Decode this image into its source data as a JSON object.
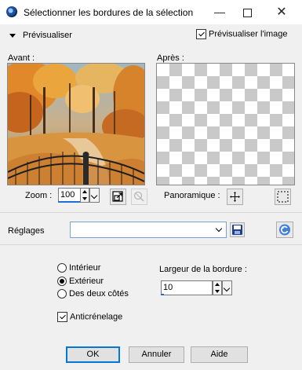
{
  "window": {
    "title": "Sélectionner les bordures de la sélection",
    "icon": "psp-app-icon",
    "min_symbol": "—",
    "close_symbol": "✕"
  },
  "preview": {
    "toggle_label": "Prévisualiser",
    "checkbox_label": "Prévisualiser l'image",
    "checkbox_checked": true
  },
  "before": {
    "label": "Avant :"
  },
  "after": {
    "label": "Après :"
  },
  "zoom": {
    "label": "Zoom :",
    "value": "100"
  },
  "pan": {
    "label": "Panoramique :"
  },
  "reglages": {
    "label": "Réglages",
    "value": ""
  },
  "options": {
    "radios": [
      {
        "label": "Intérieur",
        "checked": false
      },
      {
        "label": "Extérieur",
        "checked": true
      },
      {
        "label": "Des deux côtés",
        "checked": false
      }
    ],
    "border_width_label": "Largeur de la bordure :",
    "border_width_value": "10",
    "antialias_label": "Anticrénelage",
    "antialias_checked": true
  },
  "buttons": {
    "ok": "OK",
    "cancel": "Annuler",
    "help": "Aide"
  }
}
